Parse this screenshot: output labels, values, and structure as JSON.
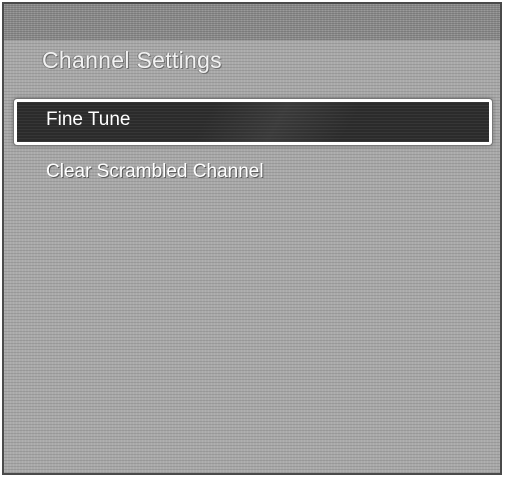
{
  "menu": {
    "title": "Channel Settings",
    "items": [
      {
        "label": "Fine Tune",
        "selected": true
      },
      {
        "label": "Clear Scrambled Channel",
        "selected": false
      }
    ]
  },
  "colors": {
    "panel_background": "#a9a9a9",
    "title_bar": "#8f8f8f",
    "selected_item_background": "#2b2b2b",
    "selected_item_border": "#ffffff",
    "text": "#ffffff"
  }
}
